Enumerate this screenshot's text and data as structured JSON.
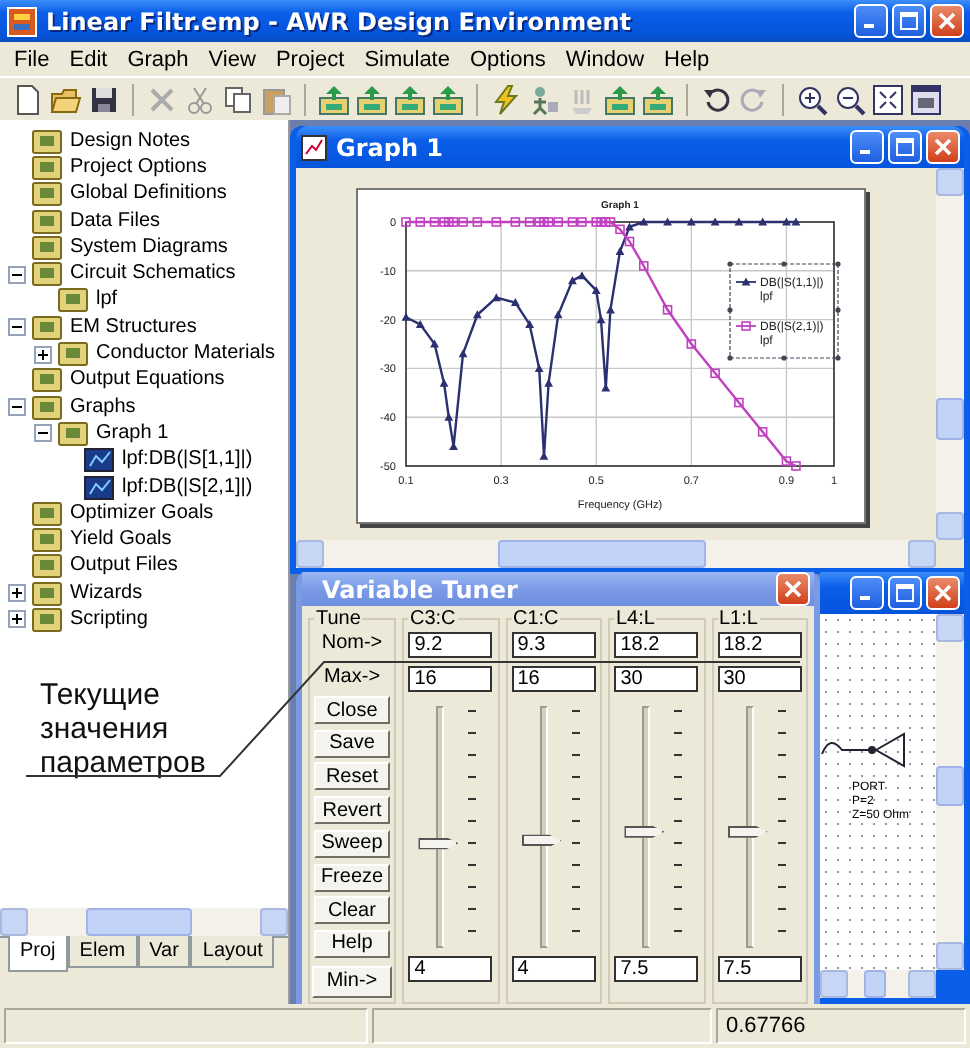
{
  "app": {
    "title": "Linear Filtr.emp - AWR Design Environment"
  },
  "menu": [
    "File",
    "Edit",
    "Graph",
    "View",
    "Project",
    "Simulate",
    "Options",
    "Window",
    "Help"
  ],
  "project_tree": [
    {
      "label": "Design Notes"
    },
    {
      "label": "Project Options"
    },
    {
      "label": "Global Definitions"
    },
    {
      "label": "Data Files"
    },
    {
      "label": "System Diagrams"
    },
    {
      "label": "Circuit Schematics",
      "expanded": true,
      "children": [
        {
          "label": "lpf"
        }
      ]
    },
    {
      "label": "EM Structures",
      "expanded": true,
      "children": [
        {
          "label": "Conductor Materials",
          "expanded": false
        }
      ]
    },
    {
      "label": "Output Equations"
    },
    {
      "label": "Graphs",
      "expanded": true,
      "children": [
        {
          "label": "Graph 1",
          "expanded": true,
          "children": [
            {
              "label": "lpf:DB(|S[1,1]|)"
            },
            {
              "label": "lpf:DB(|S[2,1]|)"
            }
          ]
        }
      ]
    },
    {
      "label": "Optimizer Goals"
    },
    {
      "label": "Yield Goals"
    },
    {
      "label": "Output Files"
    },
    {
      "label": "Wizards",
      "expanded": false
    },
    {
      "label": "Scripting",
      "expanded": false
    }
  ],
  "annotation": {
    "text": "Текущие значения параметров"
  },
  "panel_tabs": [
    {
      "label": "Proj",
      "selected": true
    },
    {
      "label": "Elem",
      "selected": false
    },
    {
      "label": "Var",
      "selected": false
    },
    {
      "label": "Layout",
      "selected": false
    }
  ],
  "graph_window": {
    "title": "Graph 1",
    "chart_data": {
      "type": "line",
      "title": "Graph 1",
      "xlabel": "Frequency (GHz)",
      "x": [
        0.1,
        0.13,
        0.16,
        0.18,
        0.19,
        0.2,
        0.22,
        0.25,
        0.29,
        0.33,
        0.36,
        0.38,
        0.39,
        0.4,
        0.42,
        0.45,
        0.47,
        0.5,
        0.51,
        0.52,
        0.53,
        0.55,
        0.57,
        0.6,
        0.65,
        0.7,
        0.75,
        0.8,
        0.85,
        0.9,
        0.92
      ],
      "series": [
        {
          "name": "DB(|S(1,1)|) lpf",
          "color": "#2b3070",
          "marker": "triangle",
          "values": [
            -19.5,
            -21,
            -25,
            -33,
            -40,
            -46,
            -27,
            -19,
            -15.5,
            -16.5,
            -21,
            -30,
            -48,
            -33,
            -19,
            -12,
            -11,
            -14,
            -20,
            -34,
            -18,
            -6,
            -1,
            0,
            0,
            0,
            0,
            0,
            0,
            0,
            0
          ]
        },
        {
          "name": "DB(|S(2,1)|) lpf",
          "color": "#c040c0",
          "marker": "square",
          "values": [
            0,
            0,
            0,
            0,
            0,
            0,
            0,
            0,
            0,
            0,
            0,
            0,
            0,
            0,
            0,
            0,
            0,
            0,
            0,
            0,
            0,
            -1.5,
            -4,
            -9,
            -18,
            -25,
            -31,
            -37,
            -43,
            -49,
            -50
          ]
        }
      ],
      "xlim": [
        0.1,
        1
      ],
      "ylim": [
        -50,
        0
      ],
      "xticks": [
        0.1,
        0.3,
        0.5,
        0.7,
        0.9,
        1
      ],
      "yticks": [
        0,
        -10,
        -20,
        -30,
        -40,
        -50
      ],
      "grid": true,
      "legend": "upper right"
    }
  },
  "tuner": {
    "title": "Variable Tuner",
    "tune_label": "Tune",
    "row_labels": {
      "nominal": "Nom->",
      "max": "Max->",
      "min": "Min->"
    },
    "buttons": [
      "Close",
      "Save",
      "Reset",
      "Revert",
      "Sweep",
      "Freeze",
      "Clear",
      "Help"
    ],
    "variables": [
      {
        "name": "C3:C",
        "nominal": "9.2",
        "max": "16",
        "min": "4",
        "level": 0.43
      },
      {
        "name": "C1:C",
        "nominal": "9.3",
        "max": "16",
        "min": "4",
        "level": 0.44
      },
      {
        "name": "L4:L",
        "nominal": "18.2",
        "max": "30",
        "min": "7.5",
        "level": 0.48
      },
      {
        "name": "L1:L",
        "nominal": "18.2",
        "max": "30",
        "min": "7.5",
        "level": 0.48
      }
    ]
  },
  "schematic_window": {
    "port_labels": [
      "PORT",
      "P=2",
      "Z=50 Ohm"
    ]
  },
  "status_bar": {
    "value": "0.67766"
  }
}
